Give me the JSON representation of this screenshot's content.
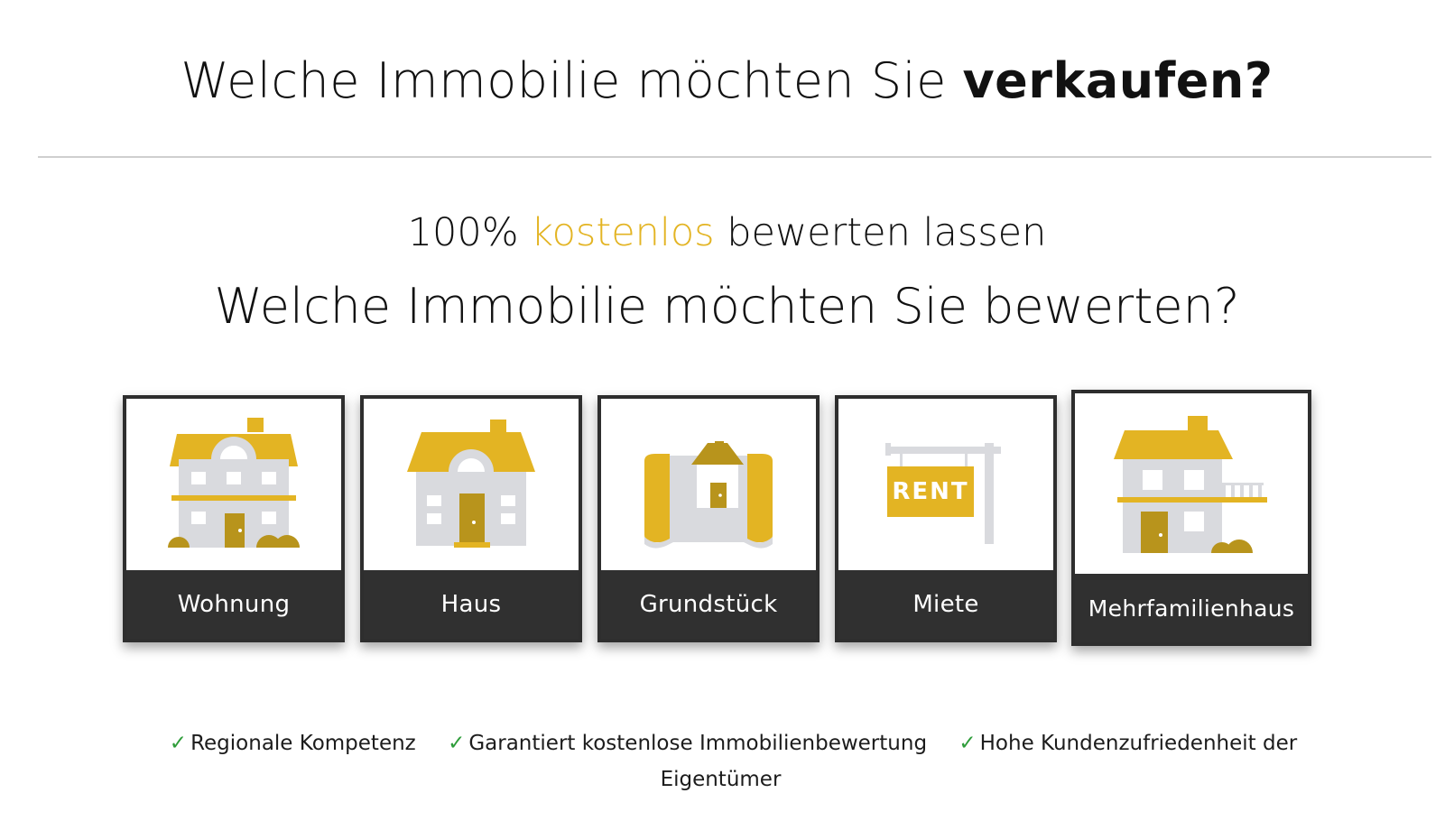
{
  "header": {
    "title_regular": "Welche Immobilie möchten Sie ",
    "title_bold": "verkaufen?"
  },
  "intro": {
    "prefix": "100% ",
    "accent": "kostenlos",
    "suffix": " bewerten lassen",
    "question": "Welche Immobilie möchten Sie bewerten?"
  },
  "options": [
    {
      "label": "Wohnung",
      "icon": "apartment-building-icon"
    },
    {
      "label": "Haus",
      "icon": "house-icon"
    },
    {
      "label": "Grundstück",
      "icon": "plot-of-land-icon"
    },
    {
      "label": "Miete",
      "icon": "rent-sign-icon"
    },
    {
      "label": "Mehrfamilienhaus",
      "icon": "multi-family-house-icon",
      "state": "hovered"
    }
  ],
  "features": [
    "Regionale Kompetenz",
    "Garantiert kostenlose Immobilienbewertung",
    "Hohe Kundenzufriedenheit der Eigentümer"
  ],
  "check_symbol": "✓",
  "colors": {
    "accent": "#e3b423",
    "accent_dark": "#b8941c",
    "card_label_bg": "#303030",
    "building_gray": "#d9dade",
    "check_green": "#2e9d3a"
  }
}
